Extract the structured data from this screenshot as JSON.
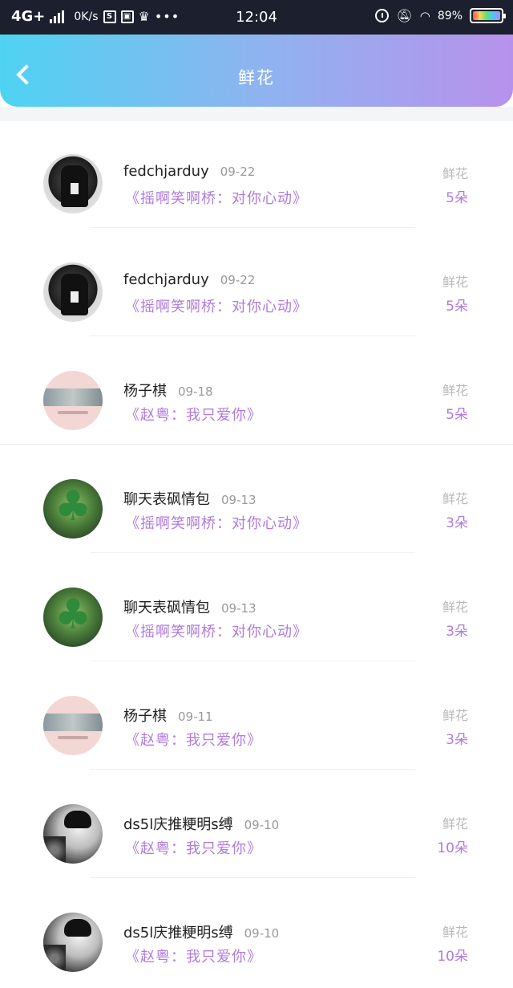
{
  "status_bar": {
    "network": "4G+",
    "speed": "0K/s",
    "time": "12:04",
    "battery_pct": "89%",
    "icons": [
      "signal-icon",
      "s-app-icon",
      "square-app-icon",
      "crown-icon",
      "more-dots-icon",
      "alarm-icon",
      "bell-muted-icon",
      "wifi-icon",
      "battery-icon"
    ]
  },
  "header": {
    "title": "鲜花",
    "back_icon": "back-arrow-icon"
  },
  "items": [
    {
      "name": "fedchjarduy",
      "date": "09-22",
      "song": "《摇啊笑啊桥：对你心动》",
      "gift_label": "鲜花",
      "gift_count": "5朵",
      "avatar": "dark"
    },
    {
      "name": "fedchjarduy",
      "date": "09-22",
      "song": "《摇啊笑啊桥：对你心动》",
      "gift_label": "鲜花",
      "gift_count": "5朵",
      "avatar": "dark"
    },
    {
      "name": "杨子棋",
      "date": "09-18",
      "song": "《赵粤：我只爱你》",
      "gift_label": "鲜花",
      "gift_count": "5朵",
      "avatar": "pink"
    },
    {
      "name": "聊天表砜情包",
      "date": "09-13",
      "song": "《摇啊笑啊桥：对你心动》",
      "gift_label": "鲜花",
      "gift_count": "3朵",
      "avatar": "clover"
    },
    {
      "name": "聊天表砜情包",
      "date": "09-13",
      "song": "《摇啊笑啊桥：对你心动》",
      "gift_label": "鲜花",
      "gift_count": "3朵",
      "avatar": "clover"
    },
    {
      "name": "杨子棋",
      "date": "09-11",
      "song": "《赵粤：我只爱你》",
      "gift_label": "鲜花",
      "gift_count": "3朵",
      "avatar": "pink"
    },
    {
      "name": "ds5l庆推粳明s缚",
      "date": "09-10",
      "song": "《赵粤：我只爱你》",
      "gift_label": "鲜花",
      "gift_count": "10朵",
      "avatar": "bw"
    },
    {
      "name": "ds5l庆推粳明s缚",
      "date": "09-10",
      "song": "《赵粤：我只爱你》",
      "gift_label": "鲜花",
      "gift_count": "10朵",
      "avatar": "bw"
    }
  ],
  "colors": {
    "accent": "#b07ae0",
    "header_start": "#4ed3f2",
    "header_end": "#b792ec"
  }
}
